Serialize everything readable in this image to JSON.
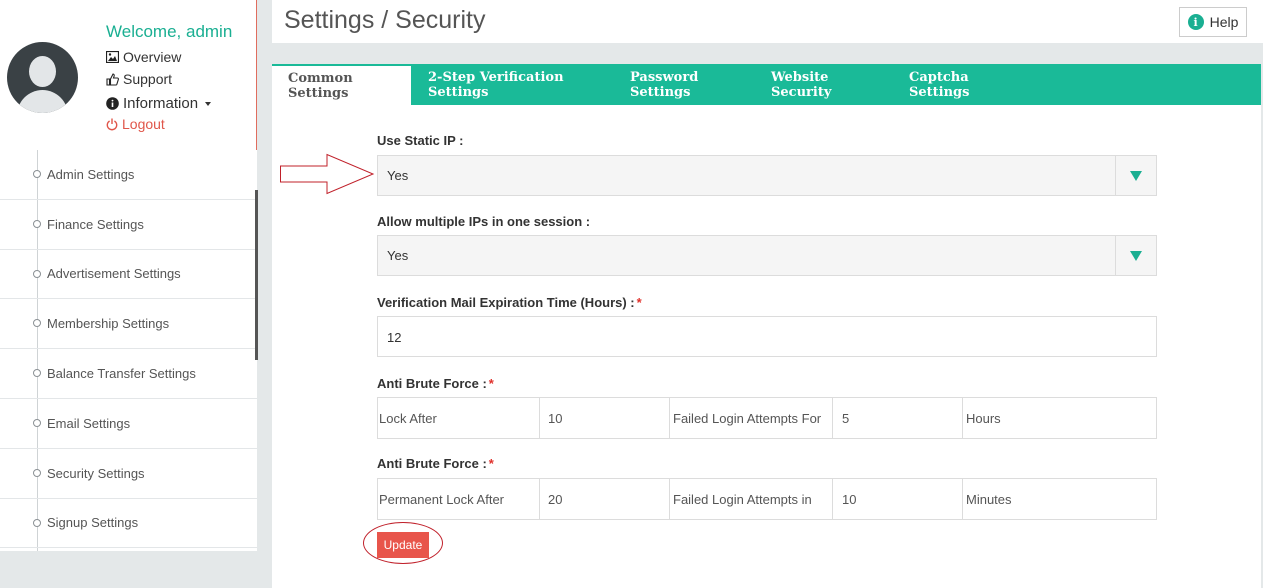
{
  "profile": {
    "welcome": "Welcome, admin",
    "overview": "Overview",
    "support": "Support",
    "information": "Information",
    "logout": "Logout"
  },
  "menu": [
    {
      "label": "Admin Settings"
    },
    {
      "label": "Finance Settings"
    },
    {
      "label": "Advertisement Settings"
    },
    {
      "label": "Membership Settings"
    },
    {
      "label": "Balance Transfer Settings"
    },
    {
      "label": "Email Settings"
    },
    {
      "label": "Security Settings"
    },
    {
      "label": "Signup Settings"
    }
  ],
  "header": {
    "title": "Settings / Security",
    "help": "Help"
  },
  "tabs": [
    {
      "label": "Common Settings",
      "active": true
    },
    {
      "label": "2-Step Verification Settings",
      "active": false
    },
    {
      "label": "Password Settings",
      "active": false
    },
    {
      "label": "Website Security",
      "active": false
    },
    {
      "label": "Captcha Settings",
      "active": false
    }
  ],
  "form": {
    "static_ip": {
      "label": "Use Static IP :",
      "value": "Yes"
    },
    "multiple_ips": {
      "label": "Allow multiple IPs in one session :",
      "value": "Yes"
    },
    "mail_expiration": {
      "label": "Verification Mail Expiration Time (Hours) :",
      "required": "*",
      "value": "12"
    },
    "brute_force_1": {
      "label": "Anti Brute Force :",
      "required": "*",
      "cells": [
        "Lock After",
        "10",
        "Failed Login Attempts For",
        "5",
        "Hours"
      ]
    },
    "brute_force_2": {
      "label": "Anti Brute Force :",
      "required": "*",
      "cells": [
        "Permanent Lock After",
        "20",
        "Failed Login Attempts in",
        "10",
        "Minutes"
      ]
    },
    "update": "Update"
  },
  "colors": {
    "accent": "#1aba98",
    "danger": "#e8554b"
  }
}
